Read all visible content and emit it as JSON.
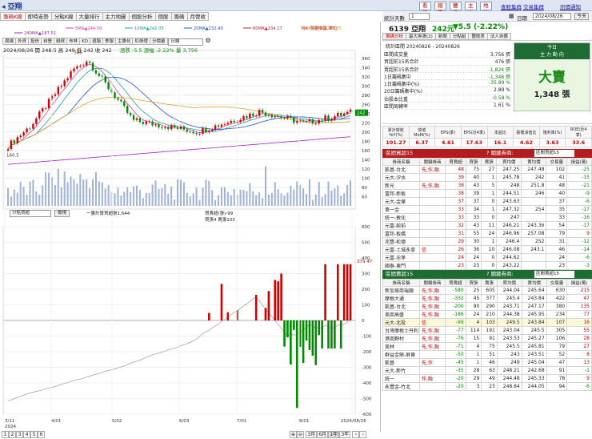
{
  "window": {
    "title": "亞翔",
    "top_buttons": [
      "看法",
      "報告",
      "體檢",
      "主力",
      "地址"
    ],
    "top_links": [
      "查股集群",
      "交易集群",
      "訊價通知"
    ]
  },
  "tabs": [
    "籌碼K線",
    "即時走勢",
    "分點K線",
    "大量排行",
    "主力地圖",
    "個股分析",
    "個股",
    "籌碼",
    "月營收"
  ],
  "ma_legend": [
    {
      "label": "5MA▲244.50",
      "color": "#e040a0"
    },
    {
      "label": "10MA▲242.05",
      "color": "#20a0a0"
    },
    {
      "label": "20MA▲232.40",
      "color": "#2050d0"
    },
    {
      "label": "60MA▲234.17",
      "color": "#c02020"
    },
    {
      "label": "60MA▲240.35",
      "color": "#e0a020"
    },
    {
      "label": "240MA▲187.51",
      "color": "#a020c0"
    }
  ],
  "ma_note": "均K 價量換算 單位",
  "subtabs": [
    "周線",
    "外資",
    "投信",
    "自營",
    "融資",
    "布林",
    "KD",
    "週報",
    "季報",
    "主籌化",
    "紅綠燈",
    "分價量"
  ],
  "period_select": "日線",
  "ohlc": "2024/08/26 開 248.5 高 249 低 242 收 242",
  "ohlc_change": "漲跌 -5.5 漲幅 -2.22% 量 3,756",
  "price_axis": [
    "360",
    "340",
    "320",
    "300",
    "280",
    "260",
    "240",
    "220",
    "200",
    "180",
    "160",
    "140",
    "120",
    "100",
    "80",
    "60"
  ],
  "hi_label": "366",
  "lo_label": "160.5",
  "lower_select": "分點買超",
  "lower_btn": "檢視",
  "lower_legend1": "一籌計算買超張1,644",
  "lower_legend2": "買賣超(張)-99",
  "lower_legend3": "買張4 賣張103",
  "lower_axis": [
    "600",
    "500",
    "400",
    "300",
    "200",
    "100",
    "0",
    "-100",
    "-200",
    "-300",
    "-400",
    "-500",
    "-600"
  ],
  "lower_peak": "379.47",
  "x_axis": [
    "3/11\n2024",
    "4/01",
    "5/02",
    "6/03",
    "7/01",
    "8/01",
    "2024/08/26"
  ],
  "pages": [
    "1",
    "2",
    "3",
    "4",
    "5",
    "6"
  ],
  "range_buttons": [
    "3月",
    "6月",
    "1年",
    "3年"
  ],
  "range_selected": "1年",
  "right_header": {
    "label": "統計天數",
    "days": "1",
    "date_label": "日期",
    "date": "2024/08/26",
    "today": "今天"
  },
  "stock": {
    "code_name": "6139 亞翔",
    "price": "242元",
    "change": "▼5.5 (-2.22%)",
    "tags": [
      "分點",
      "主力",
      "分點組",
      "分點組",
      "法人自備"
    ]
  },
  "right_tabs": [
    "籌碼分析",
    "最大券張(2)",
    "新聞",
    "分點組",
    "體檢表",
    "法人自備"
  ],
  "summary": {
    "period": "統計區間  20240826 - 20240826",
    "rows": [
      {
        "k": "區間成交量",
        "v": "3,756 張"
      },
      {
        "k": "買超前15名合計",
        "v": "476 張"
      },
      {
        "k": "賣超前15名合計",
        "v": "-1,824 張"
      },
      {
        "k": "1日籌碼集中",
        "v": "-1,348 張"
      },
      {
        "k": "1日籌碼集中(%)",
        "v": "-35.89 %"
      },
      {
        "k": "20日籌碼集中(%)",
        "v": "2.89 %"
      },
      {
        "k": "佔股本比重",
        "v": "-0.58 %"
      },
      {
        "k": "區間周轉率",
        "v": "1.61 %"
      }
    ],
    "box_title": "今日",
    "box_sub": "主 力 動 向",
    "box_big": "大賣",
    "box_val": "1,348 張"
  },
  "metrics": {
    "headers": [
      "累計營收YoY(%)",
      "營收MoM(%)",
      "EPS(季)",
      "EPS(近4季)",
      "本益比",
      "股價淨值比",
      "殖利率(%)",
      "ROE(近4季)"
    ],
    "values": [
      "101.27",
      "6.37",
      "4.61",
      "17.63",
      "16.1",
      "4.62",
      "3.63",
      "33.6"
    ]
  },
  "buy_section": {
    "title": "區間買超15",
    "filter_label": "關鍵券商:",
    "filter_value": "區間買超15",
    "headers": [
      "券商名稱",
      "關鍵券商",
      "買賣超",
      "買張",
      "賣張",
      "買均價",
      "賣均價",
      "交易量",
      "損益(萬)"
    ],
    "rows": [
      [
        "凱基-台北",
        "先,作,融",
        "48",
        "75",
        "27",
        "247.25",
        "247.48",
        "102",
        "-25"
      ],
      [
        "元大-汐水",
        "",
        "39",
        "40",
        "1",
        "245.78",
        "242",
        "41",
        "-15"
      ],
      [
        "新光",
        "先,作,融",
        "38",
        "43",
        "5",
        "248",
        "251.8",
        "48",
        "-21"
      ],
      [
        "富邦-新板",
        "",
        "38",
        "39",
        "1",
        "244.51",
        "246",
        "40",
        "-9"
      ],
      [
        "元大-金華",
        "",
        "37",
        "37",
        "0",
        "243.63",
        "",
        "37",
        "-6"
      ],
      [
        "第一金",
        "",
        "33",
        "34",
        "1",
        "247.32",
        "254",
        "35",
        "-17"
      ],
      [
        "統一-敦化",
        "",
        "33",
        "33",
        "0",
        "247",
        "",
        "33",
        "-16"
      ],
      [
        "元富-館前",
        "",
        "32",
        "43",
        "11",
        "246.21",
        "243.36",
        "54",
        "-17"
      ],
      [
        "富邦-板橋",
        "",
        "31",
        "55",
        "24",
        "246.96",
        "257.08",
        "79",
        "9"
      ],
      [
        "兆豐-松德",
        "",
        "29",
        "30",
        "1",
        "246.4",
        "252",
        "31",
        "-12"
      ],
      [
        "元富-土城永寧",
        "信",
        "26",
        "36",
        "10",
        "246.08",
        "243.1",
        "46",
        "-14"
      ],
      [
        "元富-忠孝",
        "",
        "24",
        "24",
        "0",
        "244.62",
        "",
        "24",
        "-6"
      ],
      [
        "國泰-東門",
        "",
        "23",
        "23",
        "0",
        "243.22",
        "",
        "23",
        "-3"
      ]
    ]
  },
  "sell_section": {
    "title": "區間賣超15",
    "filter_label": "關鍵券商:",
    "filter_value": "區間賣超15",
    "rows": [
      [
        "新加坡商瑞銀",
        "先,作,融",
        "-580",
        "25",
        "605",
        "244.04",
        "245.64",
        "630",
        "215"
      ],
      [
        "摩根大通",
        "先,作,融",
        "-332",
        "45",
        "377",
        "245.4",
        "243.84",
        "422",
        "47"
      ],
      [
        "凱基-台北",
        "先,作,融",
        "-200",
        "90",
        "290",
        "243.71",
        "247.17",
        "380",
        "135"
      ],
      [
        "美商高盛",
        "先,作,融",
        "-186",
        "24",
        "210",
        "244.38",
        "245.95",
        "234",
        "77"
      ],
      [
        "元大-北投",
        "信",
        "-99",
        "4",
        "103",
        "249.5",
        "243.84",
        "107",
        "16"
      ],
      [
        "台灣摩根士丹利",
        "先,作,融",
        "-77",
        "114",
        "191",
        "243.04",
        "245.5",
        "305",
        "55"
      ],
      [
        "港商野村",
        "先,作,融",
        "-76",
        "15",
        "91",
        "243.53",
        "245.27",
        "106",
        "28"
      ],
      [
        "美林",
        "先,作,融",
        "-71",
        "4",
        "75",
        "245.5",
        "245.81",
        "79",
        "27"
      ],
      [
        "群益金鼎-屏東",
        "",
        "-50",
        "1",
        "51",
        "243",
        "243.51",
        "52",
        "8"
      ],
      [
        "凱基",
        "先,作",
        "-45",
        "1",
        "46",
        "249",
        "245.04",
        "47",
        "13"
      ],
      [
        "元大-新竹",
        "",
        "-35",
        "28",
        "63",
        "248.21",
        "242.68",
        "91",
        "-1"
      ],
      [
        "統一",
        "作,融",
        "-20",
        "29",
        "49",
        "244.48",
        "245.33",
        "78",
        "9"
      ],
      [
        "永豐金-竹北",
        "",
        "-20",
        "3",
        "23",
        "248.84",
        "244.05",
        "94",
        "-6"
      ]
    ]
  },
  "chart_data": {
    "type": "line",
    "title": "",
    "price_range": [
      40,
      370
    ],
    "volume_max": 600,
    "net_buy_range": [
      -600,
      600
    ],
    "xlabel": "",
    "ylabel": ""
  }
}
